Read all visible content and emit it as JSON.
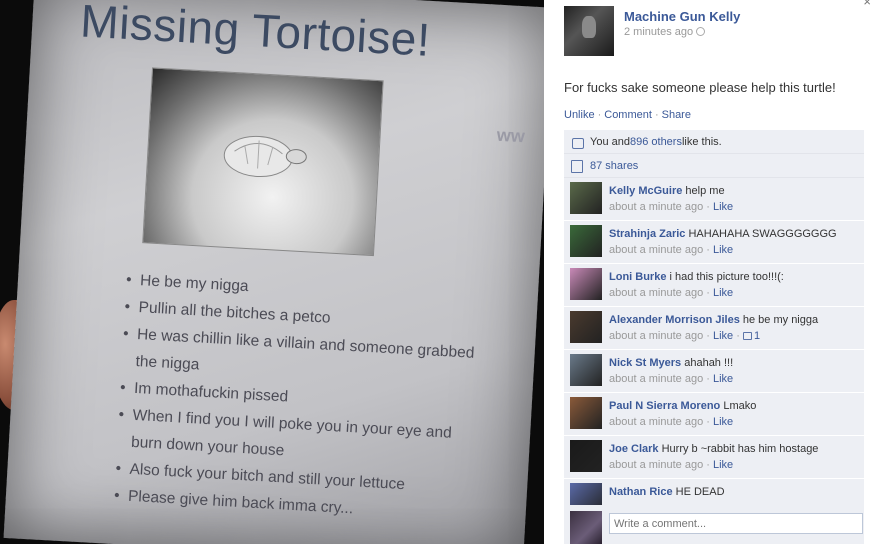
{
  "photo": {
    "title": "Missing Tortoise!",
    "watermark": "ww",
    "bullets": [
      "He be my nigga",
      "Pullin all the bitches a petco",
      "He was chillin like a villain and someone grabbed the nigga",
      "Im mothafuckin pissed",
      "When I find you I will poke you in your eye and burn down your house",
      "Also fuck your bitch and still your lettuce",
      "Please give him back imma cry..."
    ]
  },
  "post": {
    "author": "Machine Gun Kelly",
    "time": "2 minutes ago",
    "text": "For fucks sake someone please help this turtle!",
    "actions": [
      "Unlike",
      "Comment",
      "Share"
    ],
    "action_separator": "·"
  },
  "likes": {
    "prefix": "You and ",
    "others_link": "896 others",
    "suffix": " like this."
  },
  "shares": {
    "label": "87 shares"
  },
  "comments": [
    {
      "name": "Kelly McGuire",
      "text": "help me",
      "time": "about a minute ago",
      "like": "Like",
      "likes": "",
      "avatar_color": "#5a6a4a"
    },
    {
      "name": "Strahinja Zaric",
      "text": "HAHAHAHA SWAGGGGGGG",
      "time": "about a minute ago",
      "like": "Like",
      "likes": "",
      "avatar_color": "#3a6a3a"
    },
    {
      "name": "Loni Burke",
      "text": "i had this picture too!!!(:",
      "time": "about a minute ago",
      "like": "Like",
      "likes": "",
      "avatar_color": "#c98ab8"
    },
    {
      "name": "Alexander Morrison Jiles",
      "text": "he be my nigga",
      "time": "about a minute ago",
      "like": "Like",
      "likes": "1",
      "avatar_color": "#4a3a2e"
    },
    {
      "name": "Nick St Myers",
      "text": "ahahah !!!",
      "time": "about a minute ago",
      "like": "Like",
      "likes": "",
      "avatar_color": "#6a7a8a"
    },
    {
      "name": "Paul N Sierra Moreno",
      "text": "Lmako",
      "time": "about a minute ago",
      "like": "Like",
      "likes": "",
      "avatar_color": "#8a5a3a"
    },
    {
      "name": "Joe Clark",
      "text": "Hurry b ~rabbit has him hostage",
      "time": "about a minute ago",
      "like": "Like",
      "likes": "",
      "avatar_color": "#1a1a1a"
    },
    {
      "name": "Nathan Rice",
      "text": "HE DEAD",
      "time": "",
      "like": "",
      "likes": "",
      "avatar_color": "#5a6aa8"
    }
  ],
  "comment_box": {
    "placeholder": "Write a comment..."
  },
  "close_glyph": "×"
}
